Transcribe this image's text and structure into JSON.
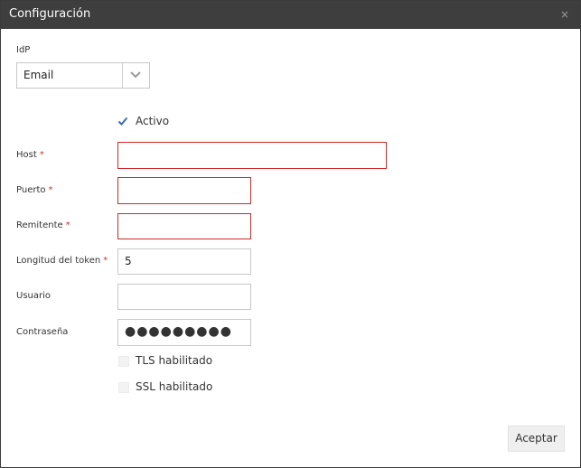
{
  "dialog": {
    "title": "Configuración",
    "close_symbol": "×"
  },
  "idp": {
    "label": "IdP",
    "selected": "Email"
  },
  "active": {
    "label": "Activo",
    "checked": true
  },
  "fields": {
    "host": {
      "label": "Host",
      "required": "*",
      "value": ""
    },
    "port": {
      "label": "Puerto",
      "required": "*",
      "value": ""
    },
    "sender": {
      "label": "Remitente",
      "required": "*",
      "value": ""
    },
    "token_length": {
      "label": "Longitud del token",
      "required": "*",
      "value": "5"
    },
    "user": {
      "label": "Usuario",
      "value": ""
    },
    "password": {
      "label": "Contraseña",
      "value": "●●●●●●●●●"
    }
  },
  "tls": {
    "label": "TLS habilitado",
    "checked": false
  },
  "ssl": {
    "label": "SSL habilitado",
    "checked": false
  },
  "footer": {
    "accept_label": "Aceptar"
  },
  "colors": {
    "titlebar": "#3e3e3e",
    "error_border": "#cc2a2a",
    "required": "#c0392b",
    "check": "#3a6ea5"
  },
  "icons": {
    "close": "close-icon",
    "select_arrow": "chevron-down-icon",
    "check": "check-icon"
  }
}
